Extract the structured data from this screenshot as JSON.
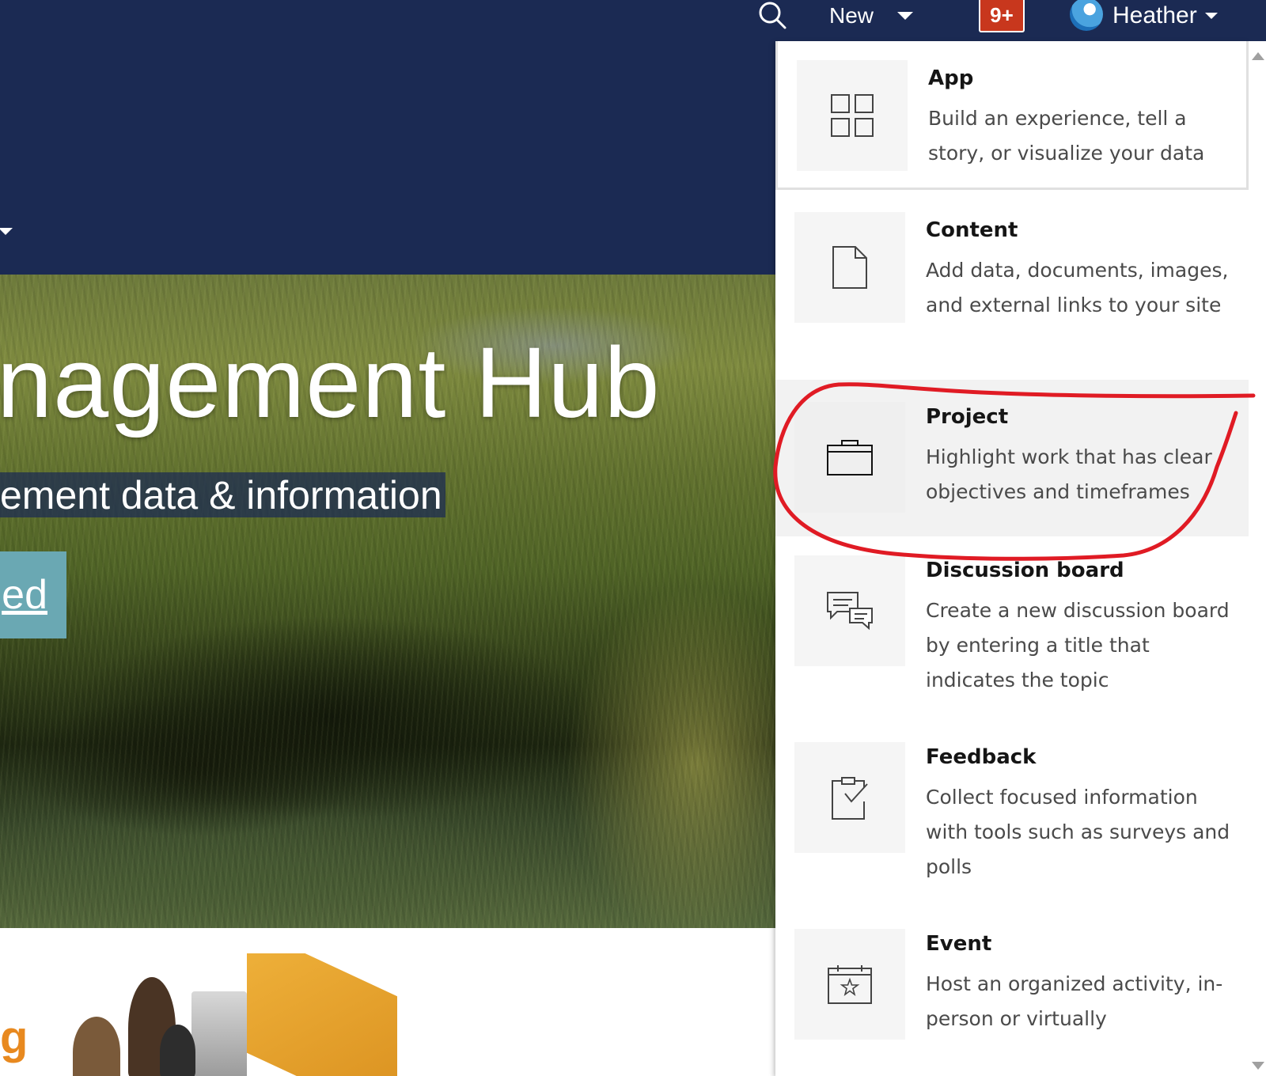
{
  "topbar": {
    "new_label": "New",
    "notifications_badge": "9+",
    "user_name": "Heather"
  },
  "hero": {
    "title": "nagement Hub",
    "subtitle": "ement data & information",
    "cta_label": "ed"
  },
  "bottom": {
    "fragment_text": "g"
  },
  "menu": {
    "items": [
      {
        "title": "App",
        "description": "Build an experience, tell a story, or visualize your data",
        "icon": "app-grid-icon"
      },
      {
        "title": "Content",
        "description": "Add data, documents, images, and external links to your site",
        "icon": "document-icon"
      },
      {
        "title": "Project",
        "description": "Highlight work that has clear objectives and timeframes",
        "icon": "briefcase-icon"
      },
      {
        "title": "Discussion board",
        "description": "Create a new discussion board by entering a title that indicates the topic",
        "icon": "chat-bubbles-icon"
      },
      {
        "title": "Feedback",
        "description": "Collect focused information with tools such as surveys and polls",
        "icon": "clipboard-check-icon"
      },
      {
        "title": "Event",
        "description": "Host an organized activity, in-person or virtually",
        "icon": "calendar-star-icon"
      }
    ]
  },
  "colors": {
    "header_bg": "#1b2a53",
    "badge_bg": "#c8371d",
    "cta_bg": "#6aa8b3",
    "annotation_red": "#e01b24"
  }
}
